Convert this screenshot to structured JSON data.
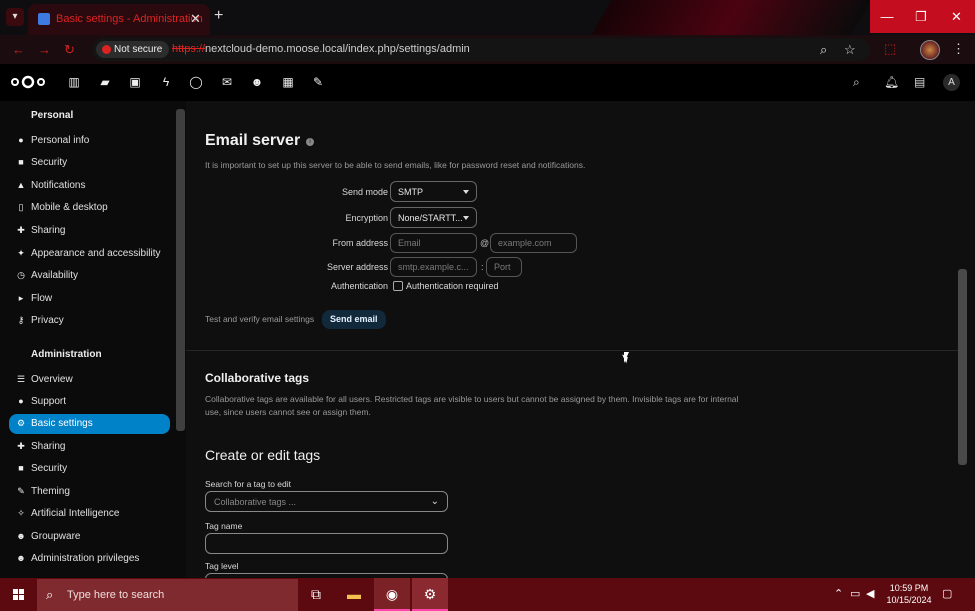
{
  "browser": {
    "tab_title": "Basic settings - Administration",
    "security_chip": "Not secure",
    "url_scheme": "https://",
    "url_rest": "nextcloud-demo.moose.local/index.php/settings/admin",
    "window_minimize": "—",
    "window_restore": "❐",
    "window_close": "✕",
    "new_tab": "+",
    "tab_close": "✕"
  },
  "nc_header": {
    "user_initial": "A"
  },
  "sidebar": {
    "personal_heading": "Personal",
    "personal_items": [
      {
        "label": "Personal info",
        "icon": "person-icon"
      },
      {
        "label": "Security",
        "icon": "lock-icon"
      },
      {
        "label": "Notifications",
        "icon": "bell-icon"
      },
      {
        "label": "Mobile & desktop",
        "icon": "phone-icon"
      },
      {
        "label": "Sharing",
        "icon": "share-icon"
      },
      {
        "label": "Appearance and accessibility",
        "icon": "palette-icon"
      },
      {
        "label": "Availability",
        "icon": "clock-icon"
      },
      {
        "label": "Flow",
        "icon": "flow-icon"
      },
      {
        "label": "Privacy",
        "icon": "key-icon"
      }
    ],
    "admin_heading": "Administration",
    "admin_items": [
      {
        "label": "Overview",
        "icon": "sliders-icon"
      },
      {
        "label": "Support",
        "icon": "chat-icon"
      },
      {
        "label": "Basic settings",
        "icon": "gear-icon",
        "active": true
      },
      {
        "label": "Sharing",
        "icon": "share-icon"
      },
      {
        "label": "Security",
        "icon": "lock-icon"
      },
      {
        "label": "Theming",
        "icon": "brush-icon"
      },
      {
        "label": "Artificial Intelligence",
        "icon": "ai-icon"
      },
      {
        "label": "Groupware",
        "icon": "group-icon"
      },
      {
        "label": "Administration privileges",
        "icon": "admin-icon"
      }
    ]
  },
  "email_server": {
    "title": "Email server",
    "description": "It is important to set up this server to be able to send emails, like for password reset and notifications.",
    "send_mode_label": "Send mode",
    "send_mode_value": "SMTP",
    "encryption_label": "Encryption",
    "encryption_value": "None/STARTT...",
    "from_address_label": "From address",
    "from_address_placeholder": "Email",
    "at_sign": "@",
    "domain_placeholder": "example.com",
    "server_address_label": "Server address",
    "server_placeholder": "smtp.example.c...",
    "colon": ":",
    "port_placeholder": "Port",
    "authentication_label": "Authentication",
    "auth_required_label": "Authentication required",
    "test_label": "Test and verify email settings",
    "send_email_button": "Send email"
  },
  "collaborative_tags": {
    "title": "Collaborative tags",
    "description": "Collaborative tags are available for all users. Restricted tags are visible to users but cannot be assigned by them. Invisible tags are for internal use, since users cannot see or assign them.",
    "edit_title": "Create or edit tags",
    "search_label": "Search for a tag to edit",
    "search_placeholder": "Collaborative tags ...",
    "tag_name_label": "Tag name",
    "tag_level_label": "Tag level"
  },
  "taskbar": {
    "search_placeholder": "Type here to search",
    "time": "10:59 PM",
    "date": "10/15/2024"
  }
}
